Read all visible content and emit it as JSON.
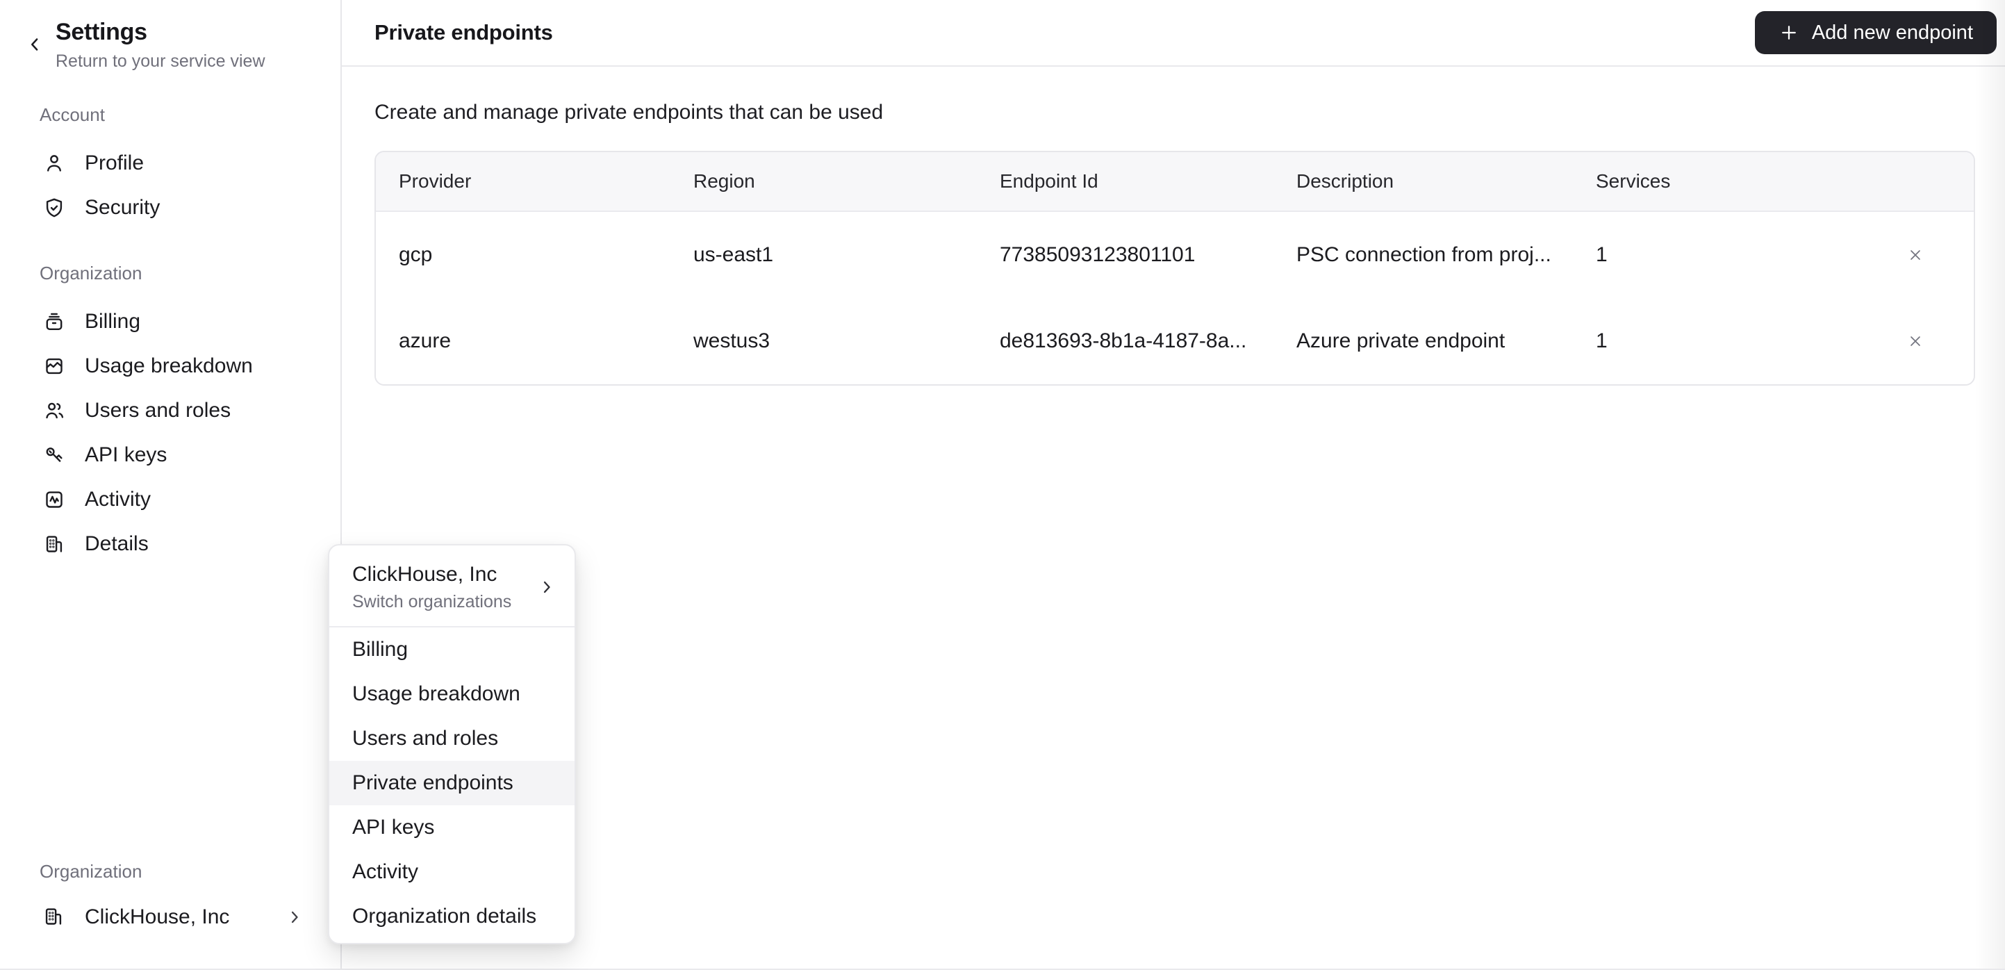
{
  "sidebar": {
    "title": "Settings",
    "subtitle": "Return to your service view",
    "account_section": {
      "label": "Account",
      "items": [
        {
          "label": "Profile",
          "icon": "user-icon"
        },
        {
          "label": "Security",
          "icon": "shield-check-icon"
        }
      ]
    },
    "organization_section": {
      "label": "Organization",
      "items": [
        {
          "label": "Billing",
          "icon": "billing-icon"
        },
        {
          "label": "Usage breakdown",
          "icon": "usage-chart-icon"
        },
        {
          "label": "Users and roles",
          "icon": "users-icon"
        },
        {
          "label": "API keys",
          "icon": "keys-icon"
        },
        {
          "label": "Activity",
          "icon": "activity-icon"
        },
        {
          "label": "Details",
          "icon": "building-icon"
        }
      ]
    },
    "footer": {
      "label": "Organization",
      "org_name": "ClickHouse, Inc",
      "icon": "building-icon"
    }
  },
  "topbar": {
    "title": "Private endpoints",
    "add_button_label": "Add new endpoint"
  },
  "content": {
    "description": "Create and manage private endpoints that can be used",
    "table": {
      "columns": [
        "Provider",
        "Region",
        "Endpoint Id",
        "Description",
        "Services"
      ],
      "rows": [
        {
          "provider": "gcp",
          "region": "us-east1",
          "endpoint_id": "77385093123801101",
          "description": "PSC connection from proj...",
          "services": "1"
        },
        {
          "provider": "azure",
          "region": "westus3",
          "endpoint_id": "de813693-8b1a-4187-8a...",
          "description": "Azure private endpoint",
          "services": "1"
        }
      ]
    }
  },
  "org_menu": {
    "header": {
      "name": "ClickHouse, Inc",
      "subtitle": "Switch organizations"
    },
    "items": [
      "Billing",
      "Usage breakdown",
      "Users and roles",
      "Private endpoints",
      "API keys",
      "Activity",
      "Organization details"
    ],
    "active_item": "Private endpoints"
  },
  "colors": {
    "button_bg": "#232329",
    "border": "#e6e6ea",
    "table_header_bg": "#f7f7f9",
    "menu_highlight": "#f4f4f6",
    "text_primary": "#1b1b1f",
    "text_secondary": "#70707b",
    "close_icon": "#73747f"
  }
}
